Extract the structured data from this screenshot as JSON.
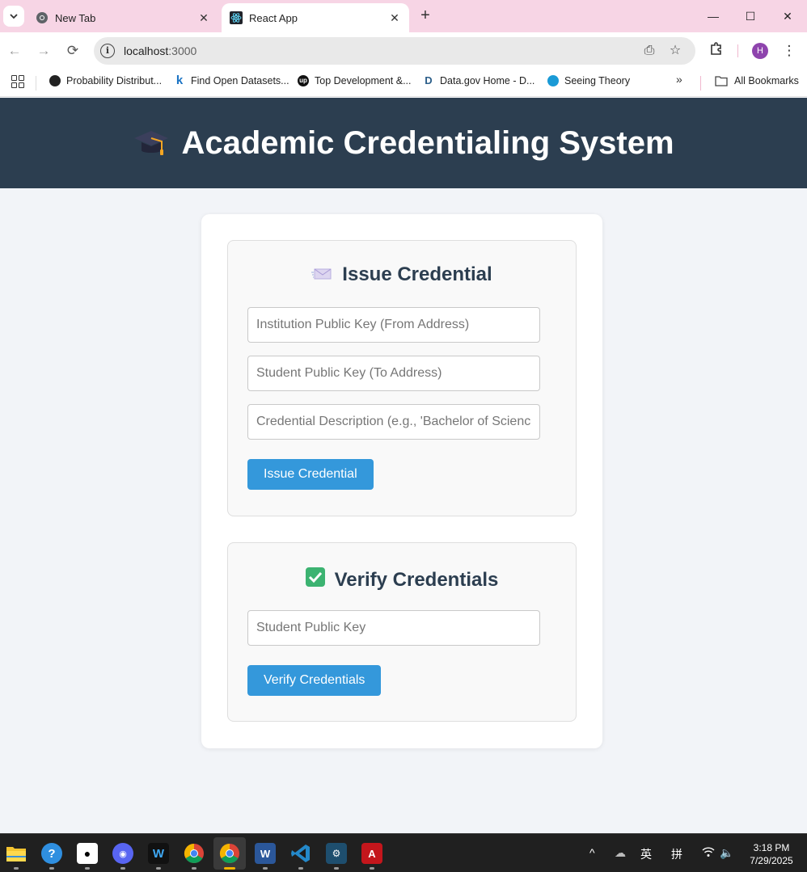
{
  "browser": {
    "tabs": [
      {
        "title": "New Tab"
      },
      {
        "title": "React App"
      }
    ],
    "address": {
      "host": "localhost",
      "port": ":3000"
    },
    "profile_initial": "H",
    "bookmarks": [
      {
        "label": "Probability Distribut..."
      },
      {
        "label": "Find Open Datasets..."
      },
      {
        "label": "Top Development &..."
      },
      {
        "label": "Data.gov Home - D..."
      },
      {
        "label": "Seeing Theory"
      }
    ],
    "all_bookmarks": "All Bookmarks"
  },
  "app": {
    "title": "Academic Credentialing System"
  },
  "issue": {
    "heading": "Issue Credential",
    "from_placeholder": "Institution Public Key (From Address)",
    "to_placeholder": "Student Public Key (To Address)",
    "desc_placeholder": "Credential Description (e.g., 'Bachelor of Science')",
    "button": "Issue Credential"
  },
  "verify": {
    "heading": "Verify Credentials",
    "key_placeholder": "Student Public Key",
    "button": "Verify Credentials"
  },
  "taskbar": {
    "ime_lang": "英",
    "ime_mode": "拼",
    "time": "3:18 PM",
    "date": "7/29/2025",
    "icons": [
      "file-explorer",
      "help",
      "qq",
      "discord",
      "webex",
      "chrome",
      "chrome-profile",
      "word",
      "vscode",
      "mysql-workbench",
      "acrobat"
    ]
  },
  "colors": {
    "header_bg": "#2c3e50",
    "button_bg": "#3498db",
    "tabbar_bg": "#f7d5e5"
  }
}
